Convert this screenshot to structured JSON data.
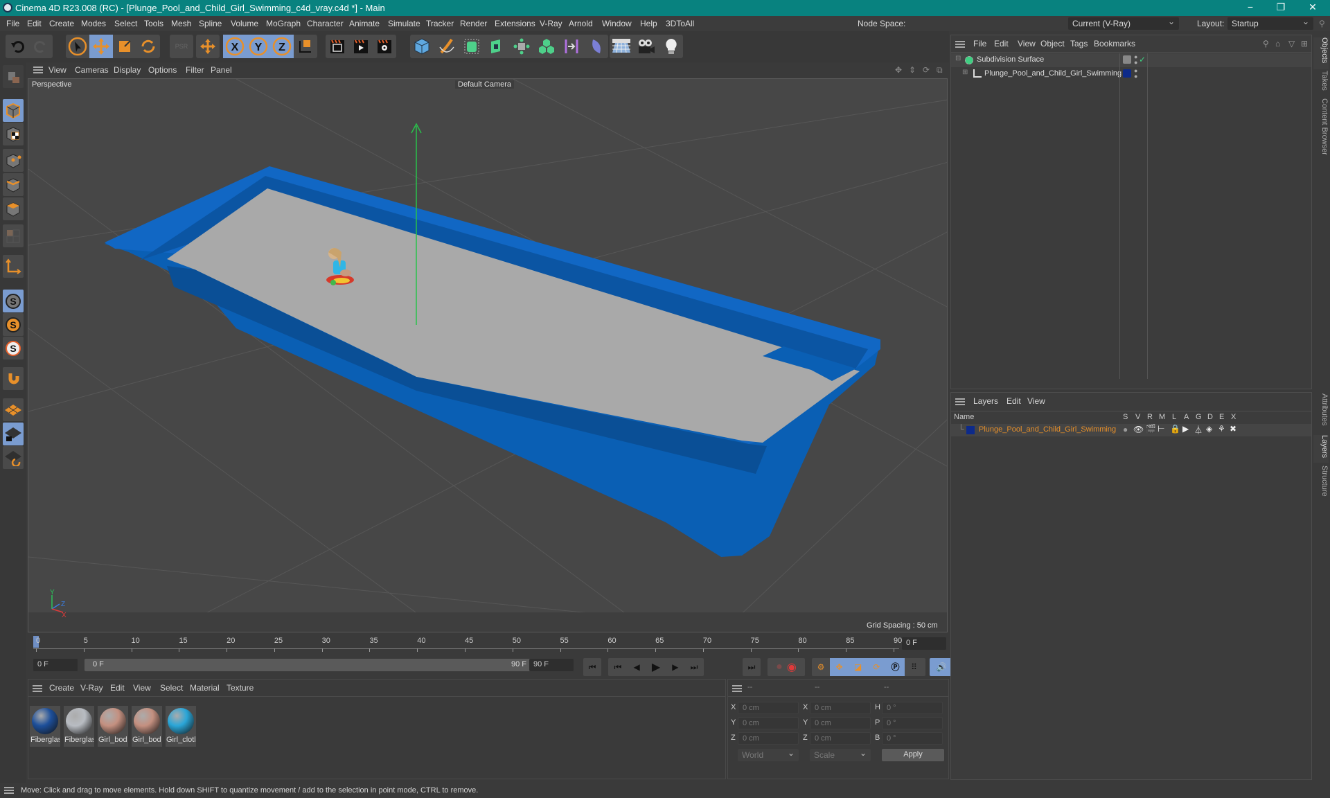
{
  "window": {
    "title": "Cinema 4D R23.008 (RC) - [Plunge_Pool_and_Child_Girl_Swimming_c4d_vray.c4d *] - Main",
    "minimize": "−",
    "maximize": "❐",
    "close": "✕"
  },
  "menubar": {
    "items": [
      "File",
      "Edit",
      "Create",
      "Modes",
      "Select",
      "Tools",
      "Mesh",
      "Spline",
      "Volume",
      "MoGraph",
      "Character",
      "Animate",
      "Simulate",
      "Tracker",
      "Render",
      "Extensions",
      "V-Ray",
      "Arnold",
      "Window",
      "Help",
      "3DToAll"
    ],
    "node_space_label": "Node Space:",
    "node_space_value": "Current (V-Ray)",
    "layout_label": "Layout:",
    "layout_value": "Startup"
  },
  "toolbar": {
    "icons": [
      "undo-icon",
      "redo-icon",
      "select-icon",
      "move-icon",
      "scale-icon",
      "rotate-icon",
      "psr-icon",
      "add-move-icon",
      "x-axis-icon",
      "y-axis-icon",
      "z-axis-icon",
      "coordinate-system-icon",
      "render-region-icon",
      "render-view-icon",
      "render-settings-icon",
      "cube-icon",
      "pen-icon",
      "subdivision-icon",
      "extrude-icon",
      "cloner-icon",
      "array-icon",
      "deformer-icon",
      "field-icon",
      "floor-icon",
      "camera-icon",
      "light-icon"
    ],
    "axis_labels": [
      "X",
      "Y",
      "Z"
    ]
  },
  "left_tools": [
    "model-mode-icon",
    "texture-mode-icon",
    "point-mode-icon",
    "edge-mode-icon",
    "polygon-mode-icon",
    "uv-mode-icon",
    "axis-mode-icon",
    "snap-icon",
    "snap-settings-icon",
    "snap-live-icon",
    "magnet-icon",
    "workplane-icon",
    "workplane-lock-icon",
    "workplane-align-icon"
  ],
  "viewport": {
    "menu": [
      "View",
      "Cameras",
      "Display",
      "Options",
      "Filter",
      "Panel"
    ],
    "view_name": "Perspective",
    "camera": "Default Camera",
    "grid_spacing": "Grid Spacing : 50 cm",
    "axis": {
      "x": "X",
      "y": "Y",
      "z": "Z"
    },
    "colors": {
      "pool_blue": "#0a5fb4",
      "pool_floor": "#a9a9a9",
      "background": "#474747"
    }
  },
  "timeline": {
    "ticks": [
      "0",
      "5",
      "10",
      "15",
      "20",
      "25",
      "30",
      "35",
      "40",
      "45",
      "50",
      "55",
      "60",
      "65",
      "70",
      "75",
      "80",
      "85",
      "90"
    ],
    "current_frame_right": "0 F",
    "start_field": "0 F",
    "range_start": "0 F",
    "range_end": "90 F",
    "end_field": "90 F"
  },
  "materials": {
    "menu": [
      "Create",
      "V-Ray",
      "Edit",
      "View",
      "Select",
      "Material",
      "Texture"
    ],
    "items": [
      {
        "name": "Fiberglas",
        "color": "#1d4f9a"
      },
      {
        "name": "Fiberglas",
        "color": "#b8bcc2"
      },
      {
        "name": "Girl_bod",
        "color": "#c49080"
      },
      {
        "name": "Girl_bod",
        "color": "#c49080"
      },
      {
        "name": "Girl_clotl",
        "color": "#2aa6d8"
      }
    ]
  },
  "coordinates": {
    "headers": [
      "--",
      "--",
      "--"
    ],
    "rows": [
      {
        "l1": "X",
        "v1": "0 cm",
        "l2": "X",
        "v2": "0 cm",
        "l3": "H",
        "v3": "0 °"
      },
      {
        "l1": "Y",
        "v1": "0 cm",
        "l2": "Y",
        "v2": "0 cm",
        "l3": "P",
        "v3": "0 °"
      },
      {
        "l1": "Z",
        "v1": "0 cm",
        "l2": "Z",
        "v2": "0 cm",
        "l3": "B",
        "v3": "0 °"
      }
    ],
    "space": "World",
    "mode": "Scale",
    "apply": "Apply"
  },
  "object_manager": {
    "menu": [
      "File",
      "Edit",
      "View",
      "Object",
      "Tags",
      "Bookmarks"
    ],
    "objects": [
      {
        "name": "Subdivision Surface"
      },
      {
        "name": "Plunge_Pool_and_Child_Girl_Swimming"
      }
    ]
  },
  "layer_manager": {
    "menu": [
      "Layers",
      "Edit",
      "View"
    ],
    "columns": [
      "Name",
      "S",
      "V",
      "R",
      "M",
      "L",
      "A",
      "G",
      "D",
      "E",
      "X"
    ],
    "layers": [
      {
        "name": "Plunge_Pool_and_Child_Girl_Swimming",
        "color": "#0d2a8a"
      }
    ]
  },
  "side_tabs": {
    "top": [
      "Objects",
      "Takes",
      "Content Browser"
    ],
    "bottom": [
      "Attributes",
      "Layers",
      "Structure"
    ]
  },
  "status": "Move: Click and drag to move elements. Hold down SHIFT to quantize movement / add to the selection in point mode, CTRL to remove."
}
